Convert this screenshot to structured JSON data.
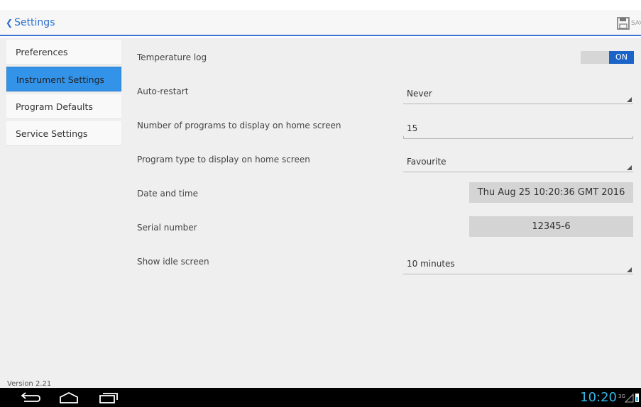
{
  "action_bar": {
    "back_label": "Settings",
    "save_label": "SAVE"
  },
  "sidebar": {
    "items": [
      {
        "label": "Preferences"
      },
      {
        "label": "Instrument Settings"
      },
      {
        "label": "Program Defaults"
      },
      {
        "label": "Service Settings"
      }
    ],
    "active_index": 1,
    "version": "Version  2.21"
  },
  "settings": {
    "temperature_log": {
      "label": "Temperature log",
      "toggle": "ON"
    },
    "auto_restart": {
      "label": "Auto-restart",
      "value": "Never"
    },
    "programs_count": {
      "label": "Number of programs to display on home screen",
      "value": "15"
    },
    "program_type": {
      "label": "Program type to display on home screen",
      "value": "Favourite"
    },
    "date_time": {
      "label": "Date and time",
      "value": "Thu Aug 25 10:20:36 GMT 2016"
    },
    "serial": {
      "label": "Serial number",
      "value": "12345-6"
    },
    "idle_screen": {
      "label": "Show idle screen",
      "value": "10 minutes"
    }
  },
  "system_bar": {
    "time": "10:20",
    "signal": "3G"
  },
  "colors": {
    "accent": "#3a6fd6",
    "selected": "#3393e8",
    "toggle_on": "#1a63c7",
    "clock": "#33b5e5"
  }
}
